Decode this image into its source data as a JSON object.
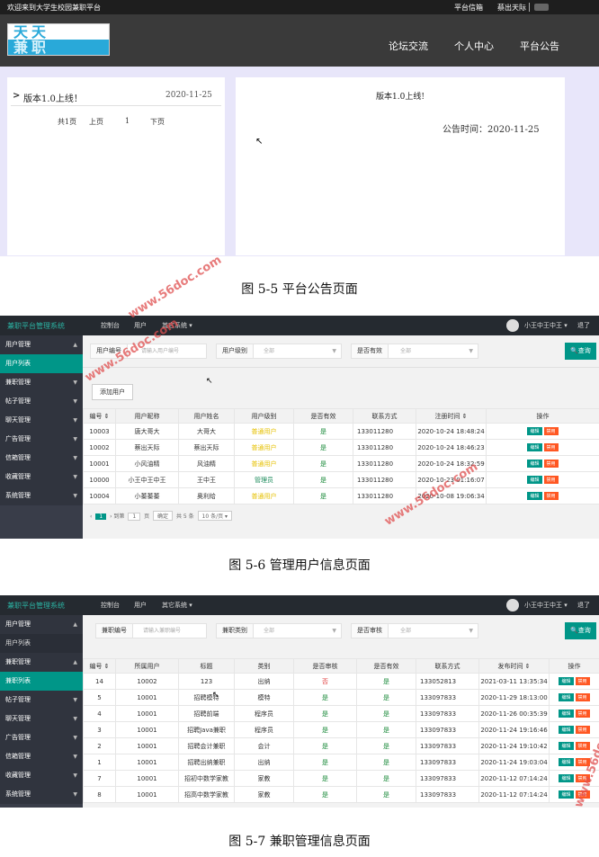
{
  "section1": {
    "welcome": "欢迎来到大学生校园兼职平台",
    "top_links": [
      "平台信箱",
      "蔡出天际"
    ],
    "logo": {
      "line1": "天天",
      "line2": "兼职"
    },
    "nav": [
      "论坛交流",
      "个人中心",
      "平台公告"
    ],
    "notice_list": {
      "marker": ">",
      "title": "版本1.0上线！",
      "date": "2020-11-25"
    },
    "pagination": {
      "total": "共1页",
      "prev": "上页",
      "current": "1",
      "next": "下页"
    },
    "detail": {
      "title": "版本1.0上线!",
      "time": "公告时间：2020-11-25"
    }
  },
  "captions": {
    "fig1": "图 5-5 平台公告页面",
    "fig2": "图 5-6 管理用户信息页面",
    "fig3": "图 5-7 兼职管理信息页面"
  },
  "watermark": "www.56doc.com",
  "admin_common": {
    "brand": "兼职平台管理系统",
    "menu": [
      "控制台",
      "用户",
      "其它系统 ▾"
    ],
    "user": "小王中王中王 ▾",
    "logout": "退了",
    "search_btn": "🔍查询"
  },
  "admin1": {
    "sidebar": [
      {
        "label": "用户管理",
        "type": "group",
        "arrow": "▲"
      },
      {
        "label": "用户列表",
        "type": "active",
        "arrow": ""
      },
      {
        "label": "兼职管理",
        "type": "group",
        "arrow": "▼"
      },
      {
        "label": "帖子管理",
        "type": "group",
        "arrow": "▼"
      },
      {
        "label": "聊天管理",
        "type": "group",
        "arrow": "▼"
      },
      {
        "label": "广告管理",
        "type": "group",
        "arrow": "▼"
      },
      {
        "label": "信箱管理",
        "type": "group",
        "arrow": "▼"
      },
      {
        "label": "收藏管理",
        "type": "group",
        "arrow": "▼"
      },
      {
        "label": "系统管理",
        "type": "group",
        "arrow": "▼"
      }
    ],
    "filters": [
      {
        "label": "用户编号",
        "value": "请输入用户编号"
      },
      {
        "label": "用户级别",
        "value": "全部"
      },
      {
        "label": "是否有效",
        "value": "全部"
      }
    ],
    "add_btn": "添加用户",
    "headers": [
      "编号 ⇕",
      "用户昵称",
      "用户姓名",
      "用户级别",
      "是否有效",
      "联系方式",
      "注册时间 ⇕",
      "操作"
    ],
    "rows": [
      [
        "10003",
        "唐大哥大",
        "大哥大",
        "普通用户",
        "是",
        "133011280",
        "2020-10-24 18:48:24"
      ],
      [
        "10002",
        "蔡出天际",
        "蔡出天际",
        "普通用户",
        "是",
        "133011280",
        "2020-10-24 18:46:23"
      ],
      [
        "10001",
        "小风油精",
        "风油精",
        "普通用户",
        "是",
        "133011280",
        "2020-10-24 18:32:59"
      ],
      [
        "10000",
        "小王中王中王",
        "王中王",
        "管理员",
        "是",
        "133011280",
        "2020-10-23 01:16:07"
      ],
      [
        "10004",
        "小蓁蓁蓁",
        "奥利给",
        "普通用户",
        "是",
        "133011280",
        "2020-10-08 19:06:34"
      ]
    ],
    "actions": {
      "edit": "编辑",
      "del": "禁用"
    },
    "pager": {
      "go": "到第",
      "page_input": "1",
      "page": "页",
      "ok": "确定",
      "total": "共 5 条",
      "size": "10 条/页 ▾",
      "cur": "1"
    }
  },
  "admin2": {
    "sidebar": [
      {
        "label": "用户管理",
        "type": "group",
        "arrow": "▲"
      },
      {
        "label": "用户列表",
        "type": "sub",
        "arrow": ""
      },
      {
        "label": "兼职管理",
        "type": "group",
        "arrow": "▲"
      },
      {
        "label": "兼职列表",
        "type": "active",
        "arrow": ""
      },
      {
        "label": "帖子管理",
        "type": "group",
        "arrow": "▼"
      },
      {
        "label": "聊天管理",
        "type": "group",
        "arrow": "▼"
      },
      {
        "label": "广告管理",
        "type": "group",
        "arrow": "▼"
      },
      {
        "label": "信箱管理",
        "type": "group",
        "arrow": "▼"
      },
      {
        "label": "收藏管理",
        "type": "group",
        "arrow": "▼"
      },
      {
        "label": "系统管理",
        "type": "group",
        "arrow": "▼"
      }
    ],
    "filters": [
      {
        "label": "兼职编号",
        "value": "请输入兼职编号"
      },
      {
        "label": "兼职类别",
        "value": "全部"
      },
      {
        "label": "是否审核",
        "value": "全部"
      }
    ],
    "headers": [
      "编号 ⇕",
      "所属用户",
      "标题",
      "类别",
      "是否审核",
      "是否有效",
      "联系方式",
      "发布时间 ⇕",
      "操作"
    ],
    "rows": [
      [
        "14",
        "10002",
        "123",
        "出纳",
        "否",
        "是",
        "133052813",
        "2021-03-11 13:35:34"
      ],
      [
        "5",
        "10001",
        "招聘模特",
        "模特",
        "是",
        "是",
        "133097833",
        "2020-11-29 18:13:00"
      ],
      [
        "4",
        "10001",
        "招聘前端",
        "程序员",
        "是",
        "是",
        "133097833",
        "2020-11-26 00:35:39"
      ],
      [
        "3",
        "10001",
        "招聘Java兼职",
        "程序员",
        "是",
        "是",
        "133097833",
        "2020-11-24 19:16:46"
      ],
      [
        "2",
        "10001",
        "招聘会计兼职",
        "会计",
        "是",
        "是",
        "133097833",
        "2020-11-24 19:10:42"
      ],
      [
        "1",
        "10001",
        "招聘出纳兼职",
        "出纳",
        "是",
        "是",
        "133097833",
        "2020-11-24 19:03:04"
      ],
      [
        "7",
        "10001",
        "招初中数学家教",
        "家教",
        "是",
        "是",
        "133097833",
        "2020-11-12 07:14:24"
      ],
      [
        "8",
        "10001",
        "招高中数学家教",
        "家教",
        "是",
        "是",
        "133097833",
        "2020-11-12 07:14:24"
      ]
    ],
    "actions": {
      "edit": "编辑",
      "del": "禁用"
    }
  }
}
